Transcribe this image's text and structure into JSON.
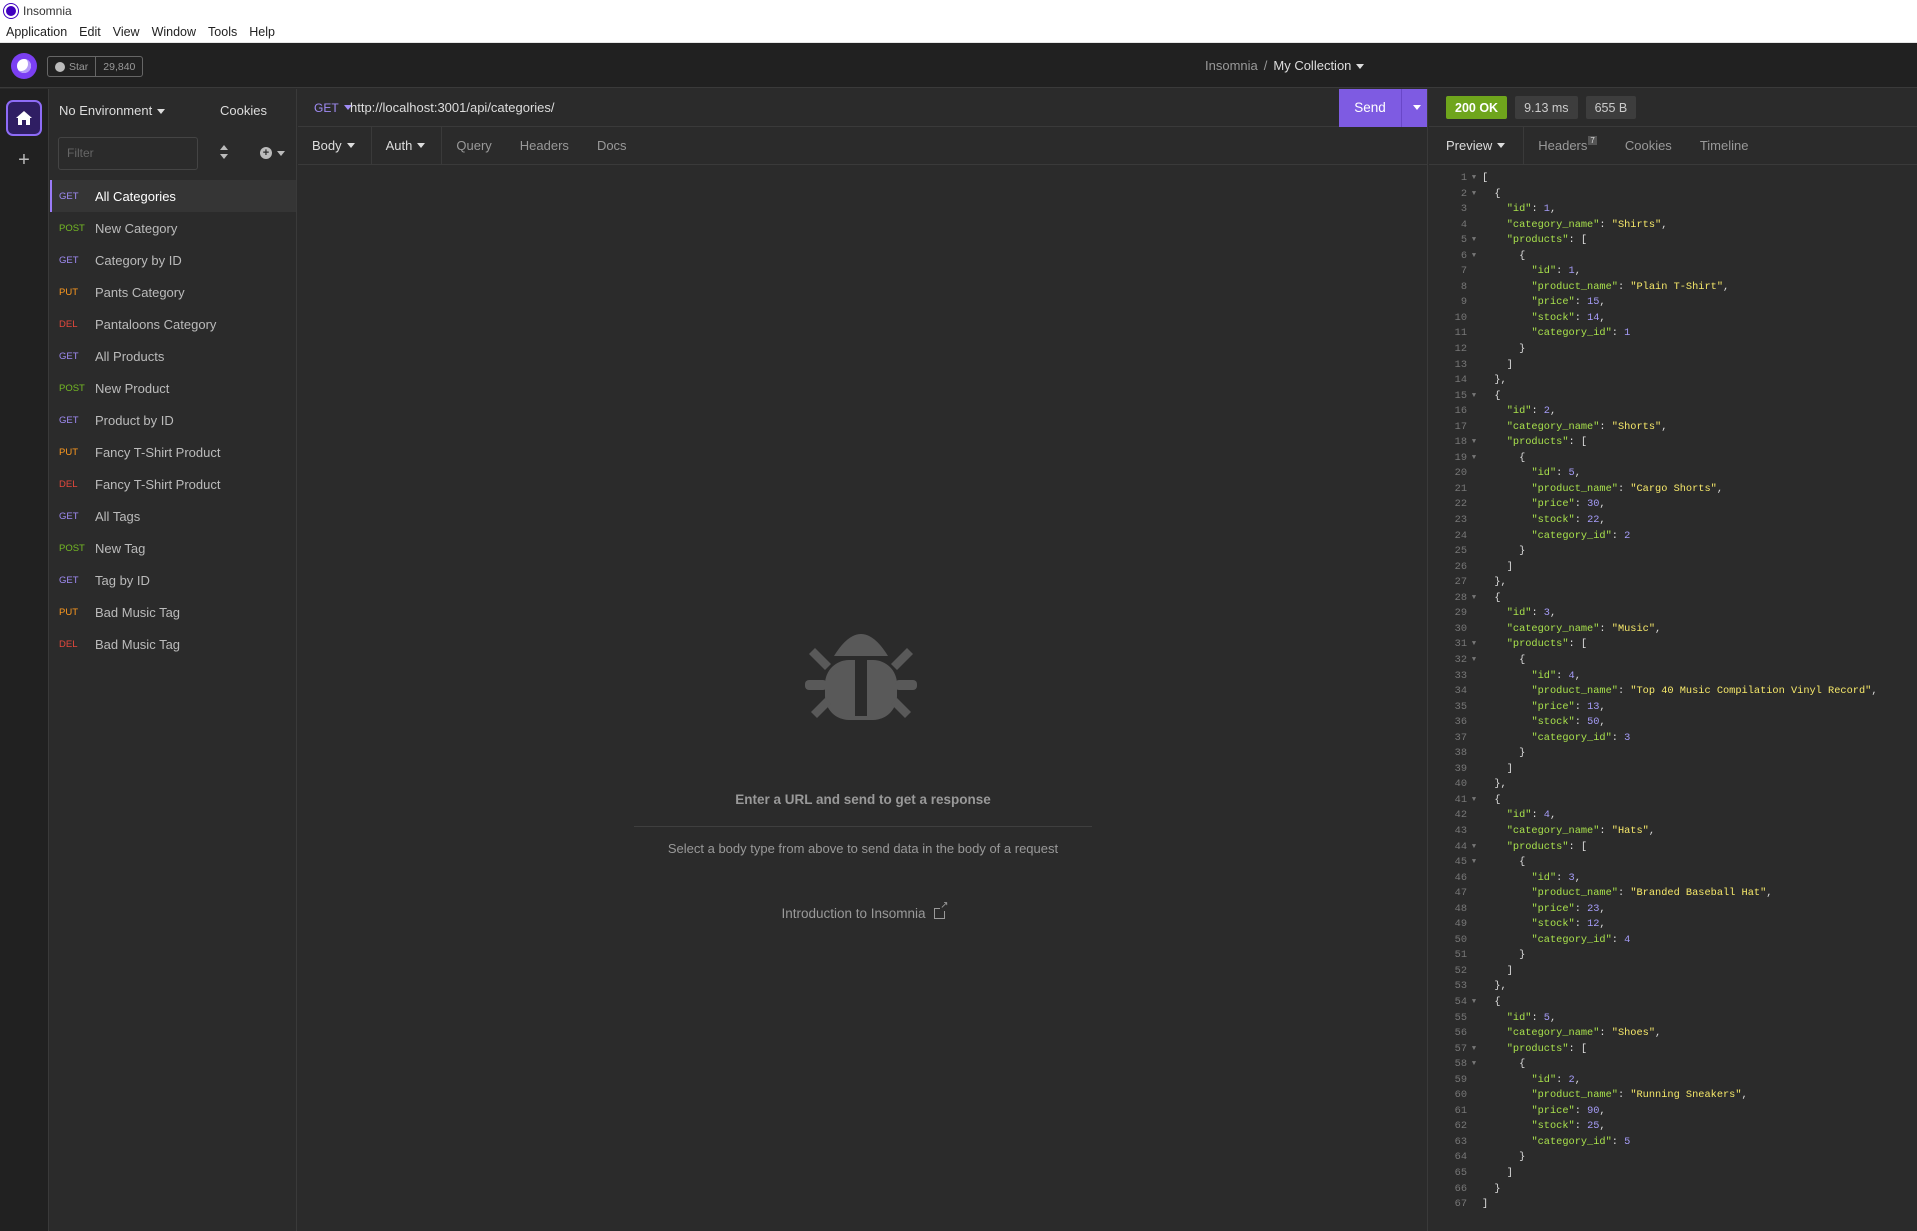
{
  "window": {
    "title": "Insomnia"
  },
  "menu": [
    "Application",
    "Edit",
    "View",
    "Window",
    "Tools",
    "Help"
  ],
  "header": {
    "star_label": "Star",
    "star_count": "29,840",
    "breadcrumb_root": "Insomnia",
    "breadcrumb_sep": "/",
    "collection": "My Collection"
  },
  "sidebar": {
    "environment": "No Environment",
    "cookies": "Cookies",
    "filter_placeholder": "Filter",
    "requests": [
      {
        "method": "GET",
        "name": "All Categories",
        "active": true
      },
      {
        "method": "POST",
        "name": "New Category"
      },
      {
        "method": "GET",
        "name": "Category by ID"
      },
      {
        "method": "PUT",
        "name": "Pants Category"
      },
      {
        "method": "DEL",
        "name": "Pantaloons Category"
      },
      {
        "method": "GET",
        "name": "All Products"
      },
      {
        "method": "POST",
        "name": "New Product"
      },
      {
        "method": "GET",
        "name": "Product by ID"
      },
      {
        "method": "PUT",
        "name": "Fancy T-Shirt Product"
      },
      {
        "method": "DEL",
        "name": "Fancy T-Shirt Product"
      },
      {
        "method": "GET",
        "name": "All Tags"
      },
      {
        "method": "POST",
        "name": "New Tag"
      },
      {
        "method": "GET",
        "name": "Tag by ID"
      },
      {
        "method": "PUT",
        "name": "Bad Music Tag"
      },
      {
        "method": "DEL",
        "name": "Bad Music Tag"
      }
    ]
  },
  "request": {
    "method": "GET",
    "url": "http://localhost:3001/api/categories/",
    "send_label": "Send",
    "tabs": {
      "body": "Body",
      "auth": "Auth",
      "query": "Query",
      "headers": "Headers",
      "docs": "Docs"
    },
    "empty_title": "Enter a URL and send to get a response",
    "empty_subtitle": "Select a body type from above to send data in the body of a request",
    "intro_link": "Introduction to Insomnia"
  },
  "response": {
    "status": "200 OK",
    "time": "9.13 ms",
    "size": "655 B",
    "tabs": {
      "preview": "Preview",
      "headers": "Headers",
      "headers_count": "7",
      "cookies": "Cookies",
      "timeline": "Timeline"
    },
    "body": [
      {
        "id": 1,
        "category_name": "Shirts",
        "products": [
          {
            "id": 1,
            "product_name": "Plain T-Shirt",
            "price": 15,
            "stock": 14,
            "category_id": 1
          }
        ]
      },
      {
        "id": 2,
        "category_name": "Shorts",
        "products": [
          {
            "id": 5,
            "product_name": "Cargo Shorts",
            "price": 30,
            "stock": 22,
            "category_id": 2
          }
        ]
      },
      {
        "id": 3,
        "category_name": "Music",
        "products": [
          {
            "id": 4,
            "product_name": "Top 40 Music Compilation Vinyl Record",
            "price": 13,
            "stock": 50,
            "category_id": 3
          }
        ]
      },
      {
        "id": 4,
        "category_name": "Hats",
        "products": [
          {
            "id": 3,
            "product_name": "Branded Baseball Hat",
            "price": 23,
            "stock": 12,
            "category_id": 4
          }
        ]
      },
      {
        "id": 5,
        "category_name": "Shoes",
        "products": [
          {
            "id": 2,
            "product_name": "Running Sneakers",
            "price": 90,
            "stock": 25,
            "category_id": 5
          }
        ]
      }
    ]
  },
  "colors": {
    "accent": "#7e5be2",
    "get": "#a08cf5",
    "post": "#75ba24",
    "put": "#ff9a1f",
    "delete": "#e5483c",
    "ok": "#6fa51c"
  }
}
